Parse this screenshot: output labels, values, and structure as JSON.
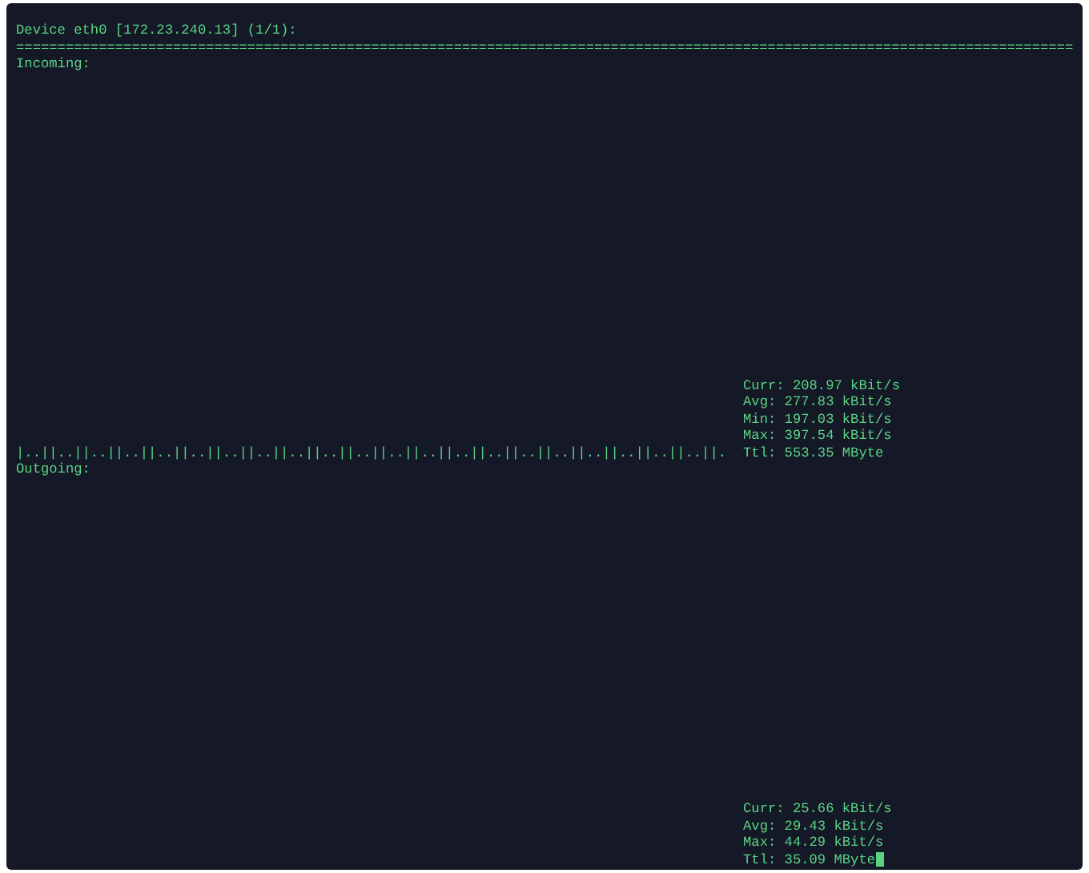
{
  "header": "Device eth0 [172.23.240.13] (1/1):",
  "separator": "================================================================================================================================",
  "sections": [
    {
      "label": "Incoming:",
      "graph": "|..||..||..||..||..||..||..||..||..||..||..||..||..||..||..||..||..||..||..||..||..||.",
      "stats": [
        "Curr: 208.97 kBit/s",
        "Avg: 277.83 kBit/s",
        "Min: 197.03 kBit/s",
        "Max: 397.54 kBit/s",
        "Ttl: 553.35 MByte"
      ]
    },
    {
      "label": "Outgoing:",
      "cursor": true,
      "stats": [
        "Curr: 25.66 kBit/s",
        "Avg: 29.43 kBit/s",
        "Max: 44.29 kBit/s",
        "Ttl: 35.09 MByte"
      ]
    }
  ]
}
